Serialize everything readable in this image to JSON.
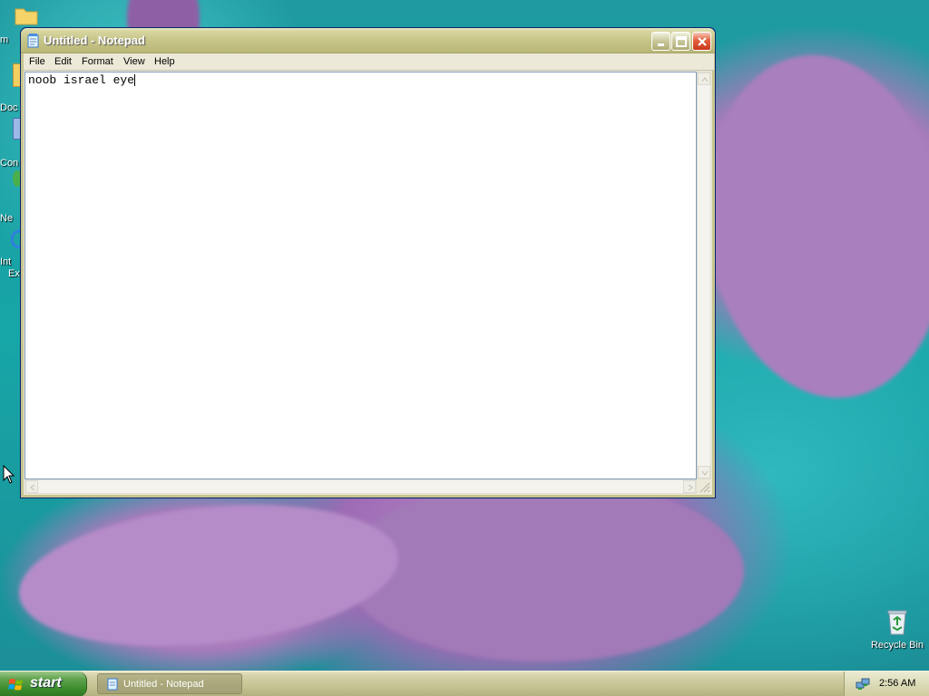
{
  "desktop": {
    "icons": [
      {
        "label": "m"
      },
      {
        "label": "Doc"
      },
      {
        "label": "Con"
      },
      {
        "label": "Ne"
      },
      {
        "label": "Int"
      },
      {
        "label": "Ex"
      }
    ],
    "recycle_bin": {
      "label": "Recycle Bin",
      "icon": "recycle-bin-icon"
    }
  },
  "window": {
    "title": "Untitled - Notepad",
    "icon": "notepad-icon",
    "menu": [
      "File",
      "Edit",
      "Format",
      "View",
      "Help"
    ],
    "content": "noob israel eye"
  },
  "taskbar": {
    "start_label": "start",
    "tasks": [
      {
        "label": "Untitled - Notepad",
        "icon": "notepad-icon"
      }
    ],
    "clock": "2:56 AM",
    "tray_icon": "network-icon"
  },
  "colors": {
    "titlebar": "#c6c588",
    "start_button": "#3a8b2a",
    "close_button": "#c7381a",
    "desktop_teal": "#1aa3a6",
    "petal_purple": "#a57bb9"
  }
}
